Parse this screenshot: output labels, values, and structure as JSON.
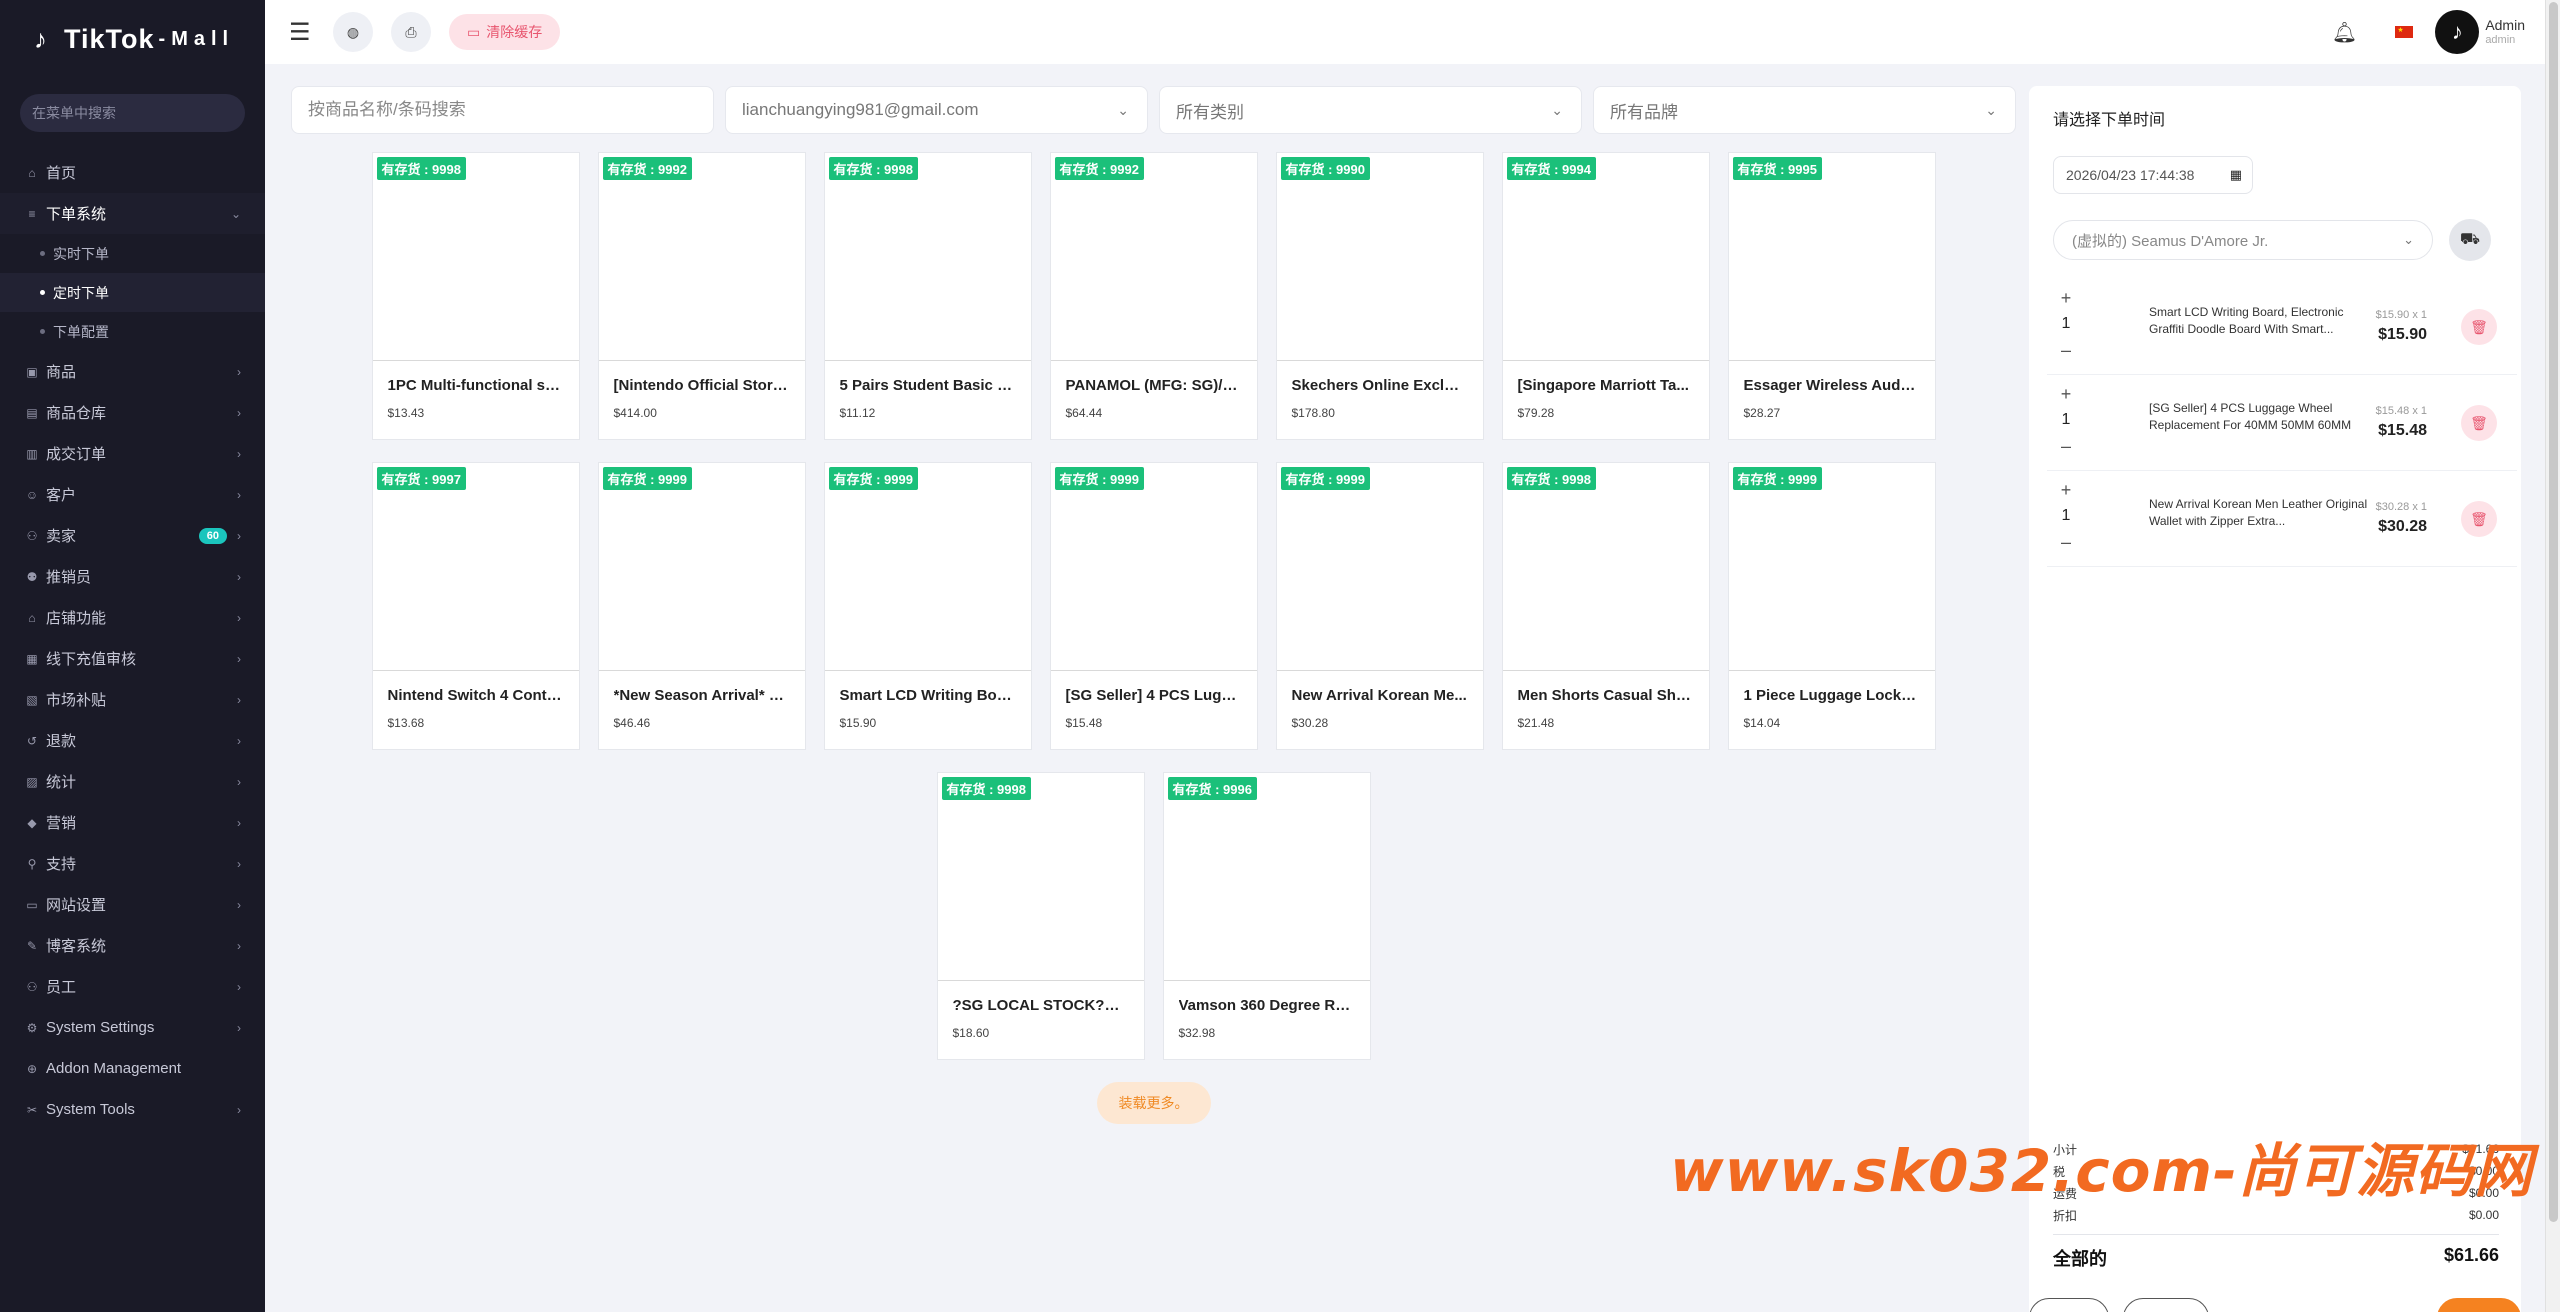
{
  "app": {
    "logo_text": "TikTok",
    "logo_suffix": "-Mall"
  },
  "sidebar": {
    "search_placeholder": "在菜单中搜索",
    "items": [
      {
        "label": "首页",
        "icon": "home-icon",
        "chevron": false
      },
      {
        "label": "下单系统",
        "icon": "list-icon",
        "chevron": true,
        "expanded": true
      },
      {
        "label": "实时下单",
        "sub": true
      },
      {
        "label": "定时下单",
        "sub": true,
        "current": true
      },
      {
        "label": "下单配置",
        "sub": true
      },
      {
        "label": "商品",
        "icon": "product-icon",
        "chevron": true
      },
      {
        "label": "商品仓库",
        "icon": "warehouse-icon",
        "chevron": true
      },
      {
        "label": "成交订单",
        "icon": "order-icon",
        "chevron": true
      },
      {
        "label": "客户",
        "icon": "customer-icon",
        "chevron": true
      },
      {
        "label": "卖家",
        "icon": "seller-icon",
        "chevron": true,
        "badge": "60"
      },
      {
        "label": "推销员",
        "icon": "salesman-icon",
        "chevron": true
      },
      {
        "label": "店铺功能",
        "icon": "shop-icon",
        "chevron": true
      },
      {
        "label": "线下充值审核",
        "icon": "recharge-icon",
        "chevron": true
      },
      {
        "label": "市场补贴",
        "icon": "subsidy-icon",
        "chevron": true
      },
      {
        "label": "退款",
        "icon": "refund-icon",
        "chevron": true
      },
      {
        "label": "统计",
        "icon": "stats-icon",
        "chevron": true
      },
      {
        "label": "营销",
        "icon": "marketing-icon",
        "chevron": true
      },
      {
        "label": "支持",
        "icon": "support-icon",
        "chevron": true
      },
      {
        "label": "网站设置",
        "icon": "monitor-icon",
        "chevron": true
      },
      {
        "label": "博客系统",
        "icon": "blog-icon",
        "chevron": true
      },
      {
        "label": "员工",
        "icon": "staff-icon",
        "chevron": true
      },
      {
        "label": "System Settings",
        "icon": "settings-icon",
        "chevron": true
      },
      {
        "label": "Addon Management",
        "icon": "addon-icon",
        "chevron": false
      },
      {
        "label": "System Tools",
        "icon": "tools-icon",
        "chevron": true
      }
    ]
  },
  "topbar": {
    "clear_cache_label": "清除缓存",
    "user_name": "Admin",
    "user_role": "admin"
  },
  "filters": {
    "search_placeholder": "按商品名称/条码搜索",
    "seller_value": "lianchuangying981@gmail.com",
    "category_value": "所有类别",
    "brand_value": "所有品牌"
  },
  "products": [
    [
      {
        "stock": "有存货 : 9998",
        "name": "1PC Multi-functional su...",
        "price": "$13.43"
      },
      {
        "stock": "有存货 : 9992",
        "name": "[Nintendo Official Store...",
        "price": "$414.00"
      },
      {
        "stock": "有存货 : 9998",
        "name": "5 Pairs Student Basic S...",
        "price": "$11.12"
      },
      {
        "stock": "有存货 : 9992",
        "name": "PANAMOL (MFG: SG)/ U...",
        "price": "$64.44"
      },
      {
        "stock": "有存货 : 9990",
        "name": "Skechers Online Exclusi...",
        "price": "$178.80"
      },
      {
        "stock": "有存货 : 9994",
        "name": "[Singapore Marriott Ta...",
        "price": "$79.28"
      },
      {
        "stock": "有存货 : 9995",
        "name": "Essager Wireless Audio...",
        "price": "$28.27"
      }
    ],
    [
      {
        "stock": "有存货 : 9997",
        "name": "Nintend Switch 4 Contr...",
        "price": "$13.68"
      },
      {
        "stock": "有存货 : 9999",
        "name": "*New Season Arrival* H...",
        "price": "$46.46"
      },
      {
        "stock": "有存货 : 9999",
        "name": "Smart LCD Writing Boar...",
        "price": "$15.90"
      },
      {
        "stock": "有存货 : 9999",
        "name": "[SG Seller] 4 PCS Lugg...",
        "price": "$15.48"
      },
      {
        "stock": "有存货 : 9999",
        "name": "New Arrival Korean Me...",
        "price": "$30.28"
      },
      {
        "stock": "有存货 : 9998",
        "name": "Men Shorts Casual Sho...",
        "price": "$21.48"
      },
      {
        "stock": "有存货 : 9999",
        "name": "1 Piece Luggage Lock S...",
        "price": "$14.04"
      }
    ],
    [
      {
        "stock": "有存货 : 9998",
        "name": "?SG LOCAL STOCK?Pet ...",
        "price": "$18.60"
      },
      {
        "stock": "有存货 : 9996",
        "name": "Vamson 360 Degree Ro...",
        "price": "$32.98"
      }
    ]
  ],
  "load_more_label": "装载更多。",
  "panel": {
    "title": "请选择下单时间",
    "datetime_value": "2026/04/23 17:44:38",
    "customer_value": "(虚拟的) Seamus D'Amore Jr.",
    "cart": [
      {
        "qty": "1",
        "name": "Smart LCD Writing Board, Electronic Graffiti Doodle Board With Smart...",
        "unit": "$15.90 x 1",
        "total": "$15.90"
      },
      {
        "qty": "1",
        "name": "[SG Seller] 4 PCS Luggage Wheel Replacement For 40MM 50MM 60MM",
        "unit": "$15.48 x 1",
        "total": "$15.48"
      },
      {
        "qty": "1",
        "name": "New Arrival Korean Men Leather Original Wallet with Zipper Extra...",
        "unit": "$30.28 x 1",
        "total": "$30.28"
      }
    ],
    "summary": {
      "subtotal_label": "小计",
      "subtotal_value": "$61.66",
      "tax_label": "税",
      "tax_value": "$0.00",
      "shipping_label": "运费",
      "shipping_value": "$0.00",
      "discount_label": "折扣",
      "discount_value": "$0.00",
      "total_label": "全部的",
      "total_value": "$61.66"
    }
  },
  "watermark": "www.sk032.com-尚可源码网",
  "colors": {
    "sidebar_bg": "#1a1a27",
    "stock_badge": "#1bc07a",
    "accent_orange": "#f58220",
    "danger_pink": "#fde2e7"
  }
}
